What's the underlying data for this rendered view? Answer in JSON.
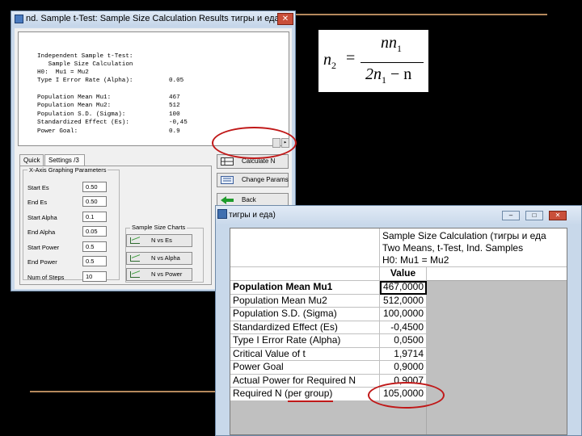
{
  "colors": {
    "background": "#000000",
    "rule": "#b5895c",
    "highlight": "#c01818",
    "window": "#c8d8ea"
  },
  "results_window": {
    "title": "nd. Sample t-Test: Sample Size Calculation Results тигры и еда",
    "close_glyph": "✕",
    "report_lines": [
      "Independent Sample t-Test:",
      "   Sample Size Calculation",
      "H0:  Mu1 = Mu2",
      "Type I Error Rate (Alpha):",
      "",
      "Population Mean Mu1:",
      "Population Mean Mu2:",
      "Population S.D. (Sigma):",
      "Standardized Effect (Es):",
      "Power Goal:"
    ],
    "report_values": [
      "",
      "",
      "",
      "0.05",
      "",
      "467",
      "512",
      "100",
      "-0,45",
      "0.9"
    ],
    "tabs": [
      "Quick",
      "Settings /3"
    ],
    "xaxis_group_title": "X-Axis Graphing Parameters",
    "params": [
      {
        "label": "Start Es",
        "value": "0.50"
      },
      {
        "label": "End Es",
        "value": "0.50"
      },
      {
        "label": "Start Alpha",
        "value": "0.1"
      },
      {
        "label": "End Alpha",
        "value": "0.05"
      },
      {
        "label": "Start Power",
        "value": "0.5"
      },
      {
        "label": "End Power",
        "value": "0.5"
      },
      {
        "label": "Num of Steps",
        "value": "10"
      }
    ],
    "chart_group_title": "Sample Size Charts",
    "chart_buttons": [
      "N vs Es",
      "N vs Alpha",
      "N vs Power"
    ],
    "side_buttons": [
      "Calculate N",
      "Change Params",
      "Back"
    ]
  },
  "formula": {
    "lhs": "n",
    "lhs_sub": "2",
    "eq": "=",
    "num": "nn",
    "num_sub": "1",
    "den_pre": "2n",
    "den_sub": "1",
    "den_post": " − n"
  },
  "spreadsheet_window": {
    "title": "тигры и еда)",
    "header_lines": [
      "Sample Size Calculation (тигры и еда",
      "Two Means, t-Test, Ind. Samples",
      "H0: Mu1 = Mu2"
    ],
    "value_header": "Value",
    "rows": [
      {
        "label": "Population Mean Mu1",
        "value": "467,0000"
      },
      {
        "label": "Population Mean Mu2",
        "value": "512,0000"
      },
      {
        "label": "Population S.D. (Sigma)",
        "value": "100,0000"
      },
      {
        "label": "Standardized Effect (Es)",
        "value": "-0,4500"
      },
      {
        "label": "Type I Error Rate (Alpha)",
        "value": "0,0500"
      },
      {
        "label": "Critical Value of t",
        "value": "1,9714"
      },
      {
        "label": "Power Goal",
        "value": "0,9000"
      },
      {
        "label": "Actual Power for Required N",
        "value": "0,9007"
      },
      {
        "label": "Required N (per group)",
        "value": "105,0000"
      }
    ],
    "window_buttons": [
      "–",
      "□",
      "✕"
    ]
  }
}
